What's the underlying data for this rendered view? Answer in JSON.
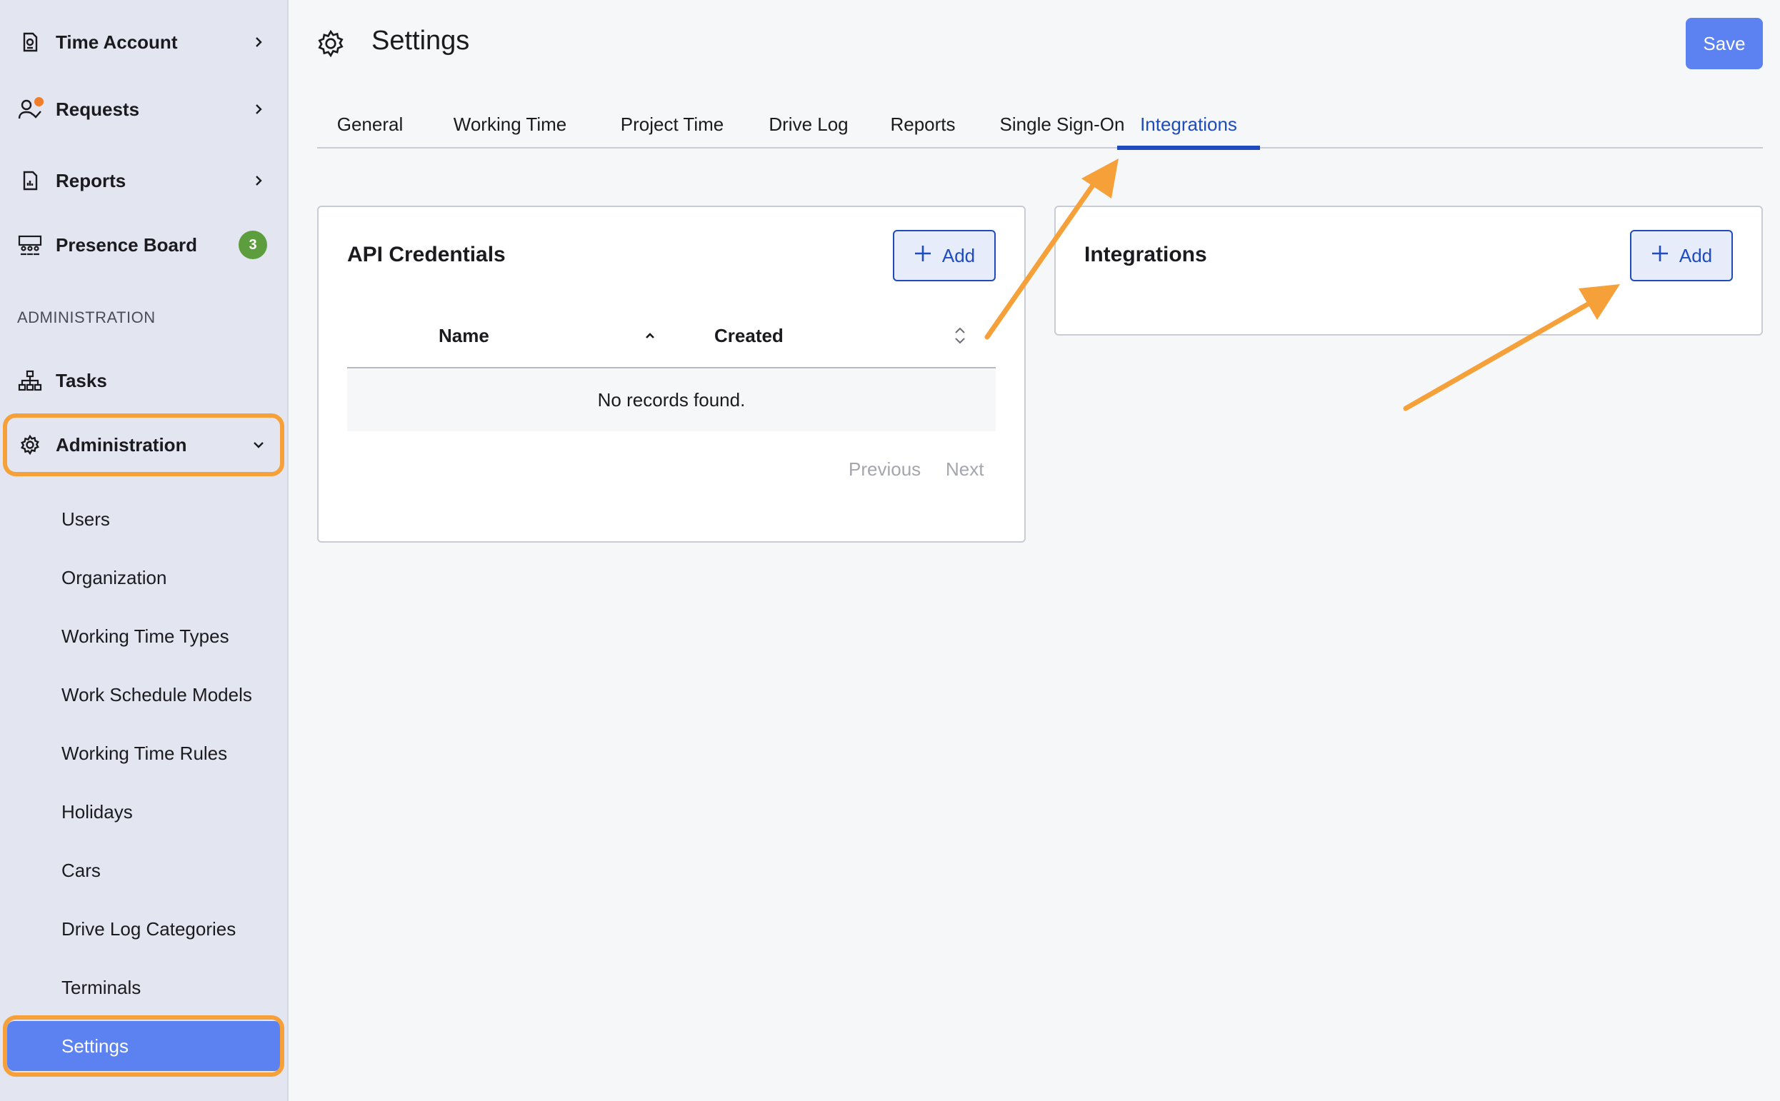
{
  "sidebar": {
    "items": [
      {
        "label": "Time Account",
        "icon": "time-account-icon"
      },
      {
        "label": "Requests",
        "icon": "requests-icon"
      },
      {
        "label": "Reports",
        "icon": "reports-icon"
      },
      {
        "label": "Presence Board",
        "icon": "presence-board-icon",
        "badge": "3"
      }
    ],
    "section_header": "ADMINISTRATION",
    "tasks_label": "Tasks",
    "administration_label": "Administration",
    "sub_items": [
      "Users",
      "Organization",
      "Working Time Types",
      "Work Schedule Models",
      "Working Time Rules",
      "Holidays",
      "Cars",
      "Drive Log Categories",
      "Terminals"
    ],
    "settings_label": "Settings"
  },
  "header": {
    "title": "Settings",
    "save_label": "Save"
  },
  "tabs": [
    {
      "label": "General"
    },
    {
      "label": "Working Time"
    },
    {
      "label": "Project Time"
    },
    {
      "label": "Drive Log"
    },
    {
      "label": "Reports"
    },
    {
      "label": "Single Sign-On"
    },
    {
      "label": "Integrations",
      "active": true
    }
  ],
  "api_credentials": {
    "title": "API Credentials",
    "add_label": "Add",
    "columns": [
      "Name",
      "Created"
    ],
    "empty_text": "No records found.",
    "previous_label": "Previous",
    "next_label": "Next"
  },
  "integrations": {
    "title": "Integrations",
    "add_label": "Add"
  },
  "colors": {
    "accent": "#1f4bbf",
    "primary_button": "#5b82f0",
    "annotation": "#f6a03a",
    "badge": "#5c9e3e",
    "notification_dot": "#f07d2a"
  }
}
